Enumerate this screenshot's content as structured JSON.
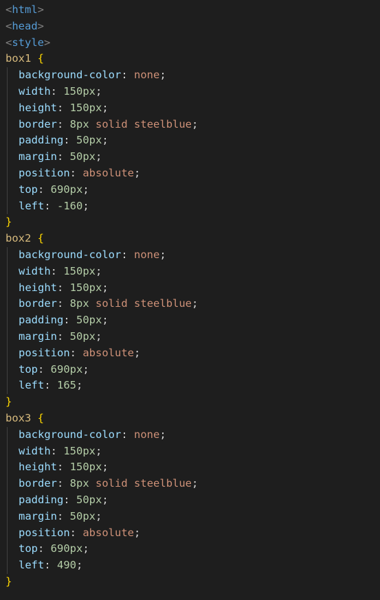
{
  "header_lines": [
    {
      "open": "<",
      "name": "html",
      "close": ">"
    },
    {
      "open": "<",
      "name": "head",
      "close": ">"
    },
    {
      "open": "<",
      "name": "style",
      "close": ">"
    }
  ],
  "rules": [
    {
      "selector": "box1",
      "open_brace": "{",
      "close_brace": "}",
      "declarations": [
        {
          "prop": "background-color",
          "value": "none",
          "value_kind": "kw"
        },
        {
          "prop": "width",
          "value": "150px",
          "value_kind": "num"
        },
        {
          "prop": "height",
          "value": "150px",
          "value_kind": "num"
        },
        {
          "prop": "border",
          "value": "8px solid steelblue",
          "value_kind": "border"
        },
        {
          "prop": "padding",
          "value": "50px",
          "value_kind": "num"
        },
        {
          "prop": "margin",
          "value": "50px",
          "value_kind": "num"
        },
        {
          "prop": "position",
          "value": "absolute",
          "value_kind": "kw"
        },
        {
          "prop": "top",
          "value": "690px",
          "value_kind": "num"
        },
        {
          "prop": "left",
          "value": "-160",
          "value_kind": "num"
        }
      ]
    },
    {
      "selector": "box2",
      "open_brace": "{",
      "close_brace": "}",
      "declarations": [
        {
          "prop": "background-color",
          "value": "none",
          "value_kind": "kw"
        },
        {
          "prop": "width",
          "value": "150px",
          "value_kind": "num"
        },
        {
          "prop": "height",
          "value": "150px",
          "value_kind": "num"
        },
        {
          "prop": "border",
          "value": "8px solid steelblue",
          "value_kind": "border"
        },
        {
          "prop": "padding",
          "value": "50px",
          "value_kind": "num"
        },
        {
          "prop": "margin",
          "value": "50px",
          "value_kind": "num"
        },
        {
          "prop": "position",
          "value": "absolute",
          "value_kind": "kw"
        },
        {
          "prop": "top",
          "value": "690px",
          "value_kind": "num"
        },
        {
          "prop": "left",
          "value": "165",
          "value_kind": "num"
        }
      ]
    },
    {
      "selector": "box3",
      "open_brace": "{",
      "close_brace": "}",
      "declarations": [
        {
          "prop": "background-color",
          "value": "none",
          "value_kind": "kw"
        },
        {
          "prop": "width",
          "value": "150px",
          "value_kind": "num"
        },
        {
          "prop": "height",
          "value": "150px",
          "value_kind": "num"
        },
        {
          "prop": "border",
          "value": "8px solid steelblue",
          "value_kind": "border"
        },
        {
          "prop": "padding",
          "value": "50px",
          "value_kind": "num"
        },
        {
          "prop": "margin",
          "value": "50px",
          "value_kind": "num"
        },
        {
          "prop": "position",
          "value": "absolute",
          "value_kind": "kw"
        },
        {
          "prop": "top",
          "value": "690px",
          "value_kind": "num"
        },
        {
          "prop": "left",
          "value": "490",
          "value_kind": "num"
        }
      ]
    }
  ],
  "colors": {
    "background": "#1e1e1e",
    "tag_bracket": "#808080",
    "tag_name": "#569cd6",
    "selector": "#d7ba7d",
    "brace": "#ffd700",
    "property": "#9cdcfe",
    "number": "#b5cea8",
    "keyword": "#ce9178"
  }
}
